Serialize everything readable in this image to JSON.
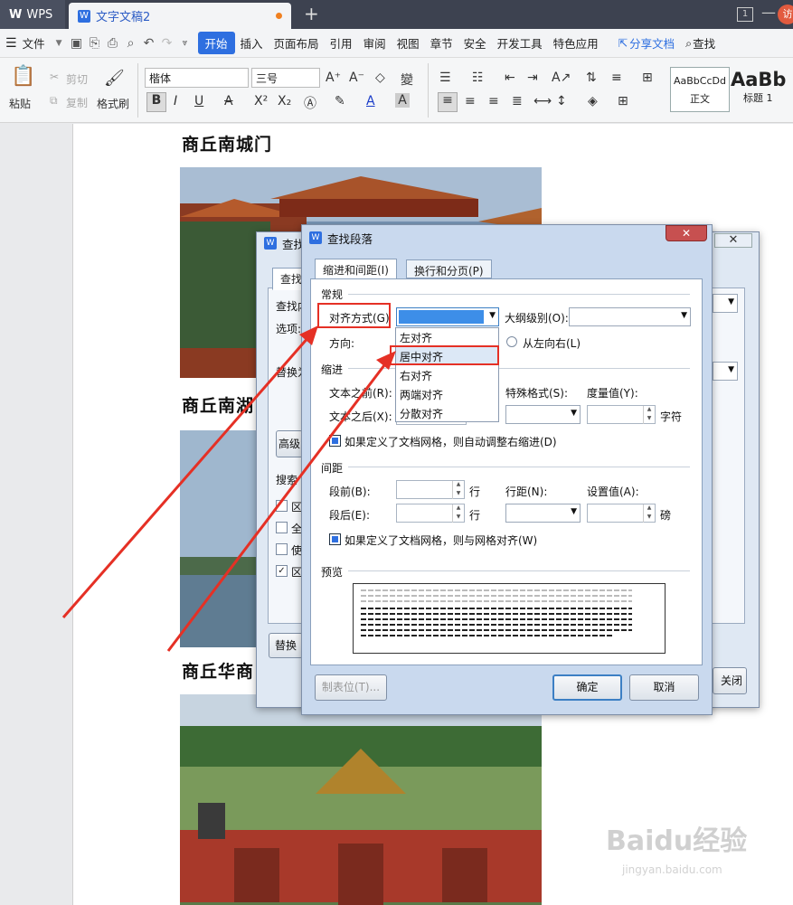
{
  "titlebar": {
    "app": "WPS",
    "doc_tab": "文字文稿2",
    "new_tab": "+",
    "window_count": "1",
    "minimize": "—",
    "user_avatar": "访"
  },
  "menu": {
    "file": "文件",
    "items": [
      "开始",
      "插入",
      "页面布局",
      "引用",
      "审阅",
      "视图",
      "章节",
      "安全",
      "开发工具",
      "特色应用"
    ],
    "share": "分享文档",
    "search": "查找"
  },
  "ribbon": {
    "paste": "粘贴",
    "cut": "剪切",
    "copy": "复制",
    "format_painter": "格式刷",
    "font": "楷体",
    "size": "三号",
    "style_normal_sample": "AaBbCcDd",
    "style_normal": "正文",
    "style_h1_sample": "AaBb",
    "style_h1": "标题 1"
  },
  "document": {
    "heading1": "商丘南城门",
    "heading2": "商丘南湖",
    "heading3": "商丘华商"
  },
  "bg_dialog": {
    "title": "查找",
    "tab": "查找",
    "find_label": "查找内",
    "options_label": "选项:",
    "replace_label": "替换为",
    "advanced": "高级",
    "search_label": "搜索",
    "check_items": [
      "区",
      "全",
      "使",
      "区"
    ],
    "replace_button": "替换",
    "close_button": "关闭"
  },
  "dialog": {
    "title": "查找段落",
    "tab_indent": "缩进和间距(I)",
    "tab_linebreak": "换行和分页(P)",
    "group_general": "常规",
    "align_label": "对齐方式(G)",
    "outline_label": "大纲级别(O):",
    "direction_label": "方向:",
    "rtl_label": "从左向右(L)",
    "group_indent": "缩进",
    "before_text_label": "文本之前(R):",
    "after_text_label": "文本之后(X):",
    "special_label": "特殊格式(S):",
    "measure_label": "度量值(Y):",
    "unit_char": "字符",
    "grid_indent_label": "如果定义了文档网格，则自动调整右缩进(D)",
    "group_spacing": "间距",
    "before_label": "段前(B):",
    "after_label": "段后(E):",
    "unit_line": "行",
    "line_spacing_label": "行距(N):",
    "setting_label": "设置值(A):",
    "unit_pound": "磅",
    "grid_align_label": "如果定义了文档网格，则与网格对齐(W)",
    "group_preview": "预览",
    "tabs_button": "制表位(T)...",
    "ok_button": "确定",
    "cancel_button": "取消",
    "align_options": [
      "左对齐",
      "居中对齐",
      "右对齐",
      "两端对齐",
      "分散对齐"
    ],
    "highlighted_option": "居中对齐"
  },
  "watermark": {
    "text": "Baidu经验",
    "url": "jingyan.baidu.com"
  },
  "colors": {
    "accent": "#2e6fe0",
    "annotation_red": "#e53025",
    "dialog_bg": "#c9d9ee"
  }
}
